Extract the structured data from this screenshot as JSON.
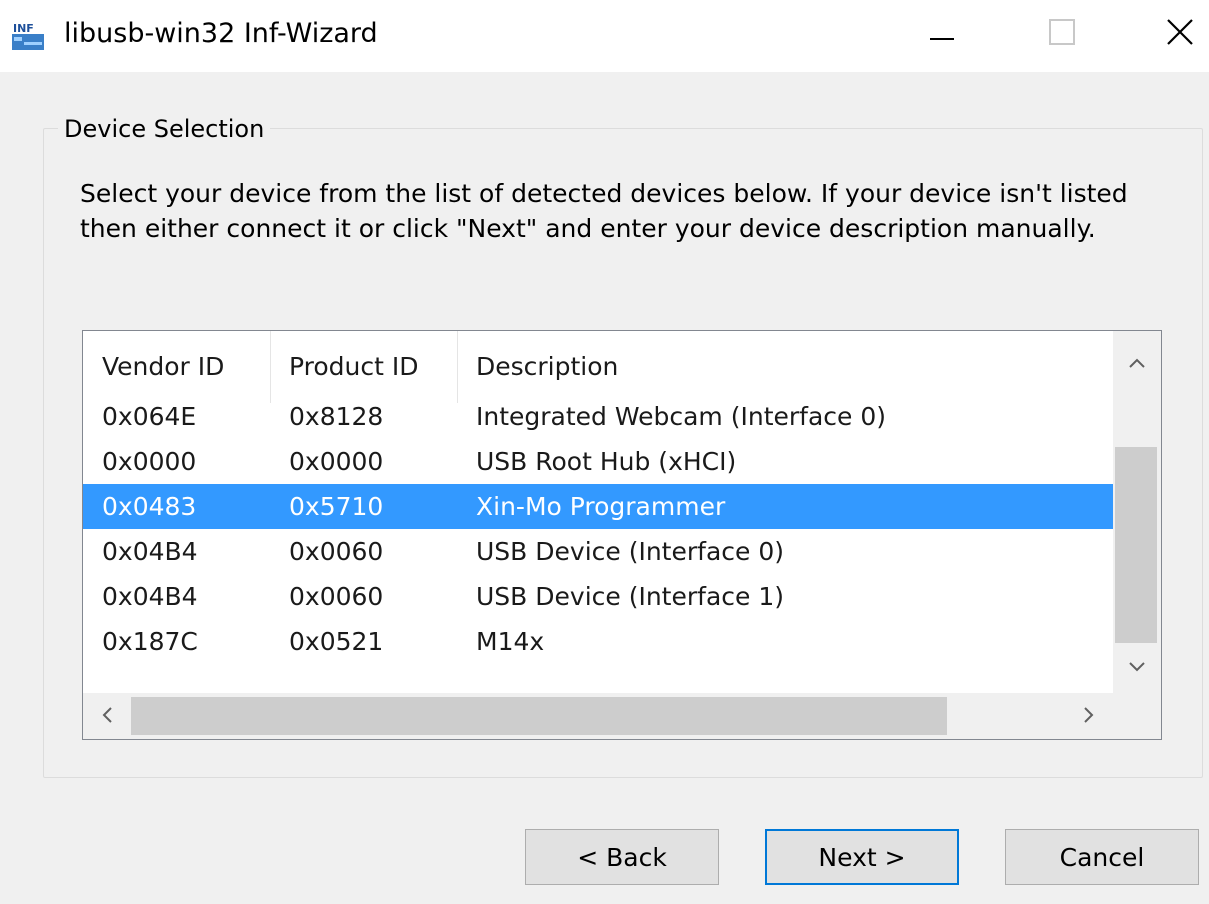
{
  "window": {
    "title": "libusb-win32 Inf-Wizard",
    "icon_text": "INF"
  },
  "group": {
    "label": "Device Selection",
    "instructions": "Select your device from the list of detected devices below. If your device isn't listed then either connect it or click \"Next\" and enter your device description manually."
  },
  "list": {
    "columns": [
      "Vendor ID",
      "Product ID",
      "Description"
    ],
    "rows": [
      {
        "vendor": "0x064E",
        "product": "0x8128",
        "description": "Integrated Webcam (Interface 0)",
        "selected": false
      },
      {
        "vendor": "0x0000",
        "product": "0x0000",
        "description": "USB Root Hub (xHCI)",
        "selected": false
      },
      {
        "vendor": "0x0483",
        "product": "0x5710",
        "description": "Xin-Mo Programmer",
        "selected": true
      },
      {
        "vendor": "0x04B4",
        "product": "0x0060",
        "description": "USB Device (Interface 0)",
        "selected": false
      },
      {
        "vendor": "0x04B4",
        "product": "0x0060",
        "description": "USB Device (Interface 1)",
        "selected": false
      },
      {
        "vendor": "0x187C",
        "product": "0x0521",
        "description": "M14x",
        "selected": false
      }
    ],
    "selection_color": "#3399ff"
  },
  "buttons": {
    "back": "< Back",
    "next": "Next >",
    "cancel": "Cancel"
  },
  "icons": {
    "minimize": "minimize-icon",
    "maximize": "maximize-icon",
    "close": "close-icon",
    "scroll_up": "chevron-up-icon",
    "scroll_down": "chevron-down-icon",
    "scroll_left": "chevron-left-icon",
    "scroll_right": "chevron-right-icon"
  }
}
